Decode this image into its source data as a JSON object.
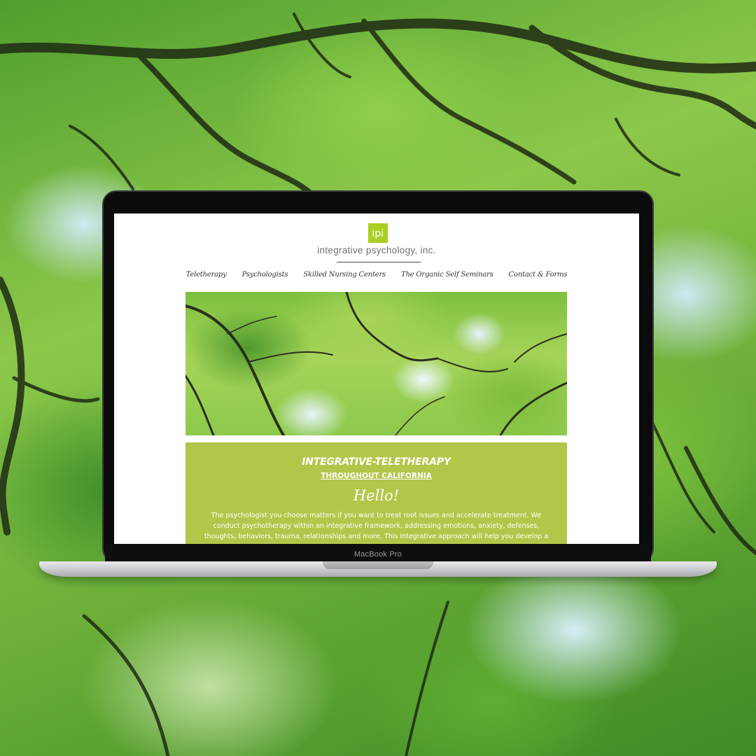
{
  "device": {
    "model_label": "MacBook Pro"
  },
  "site": {
    "logo_badge": "ipi",
    "logo_text": "integrative psychology, inc.",
    "brand_color": "#a9cf23",
    "nav": [
      {
        "label": "Teletherapy"
      },
      {
        "label": "Psychologists"
      },
      {
        "label": "Skilled Nursing Centers"
      },
      {
        "label": "The Organic Self Seminars"
      },
      {
        "label": "Contact & Forms"
      }
    ],
    "panel": {
      "title": "INTEGRATIVE-TELETHERAPY",
      "subtitle": "THROUGHOUT CALIFORNIA",
      "greeting": "Hello!",
      "body": "The psychologist you choose matters if you want to treat root issues and accelerate treatment. We conduct psychotherapy within an integrative framework, addressing emotions, anxiety, defenses, thoughts, behaviors, trauma, relationships and more. This integrative approach will help you develop a deeper",
      "background_color": "#b4c64a"
    }
  }
}
